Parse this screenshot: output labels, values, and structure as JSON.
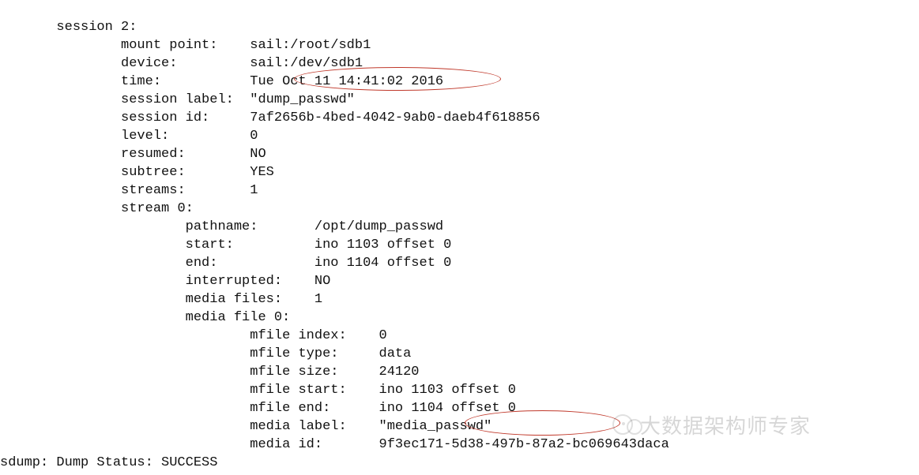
{
  "session": {
    "header": "session 2:",
    "mount_point_label": "mount point:",
    "mount_point_value": "sail:/root/sdb1",
    "device_label": "device:",
    "device_value": "sail:/dev/sdb1",
    "time_label": "time:",
    "time_value": "Tue Oct 11 14:41:02 2016",
    "session_label_label": "session label:",
    "session_label_value": "\"dump_passwd\"",
    "session_id_label": "session id:",
    "session_id_value": "7af2656b-4bed-4042-9ab0-daeb4f618856",
    "level_label": "level:",
    "level_value": "0",
    "resumed_label": "resumed:",
    "resumed_value": "NO",
    "subtree_label": "subtree:",
    "subtree_value": "YES",
    "streams_label": "streams:",
    "streams_value": "1",
    "stream0_header": "stream 0:"
  },
  "stream": {
    "pathname_label": "pathname:",
    "pathname_value": "/opt/dump_passwd",
    "start_label": "start:",
    "start_value": "ino 1103 offset 0",
    "end_label": "end:",
    "end_value": "ino 1104 offset 0",
    "interrupted_label": "interrupted:",
    "interrupted_value": "NO",
    "media_files_label": "media files:",
    "media_files_value": "1",
    "media_file0_header": "media file 0:"
  },
  "mfile": {
    "index_label": "mfile index:",
    "index_value": "0",
    "type_label": "mfile type:",
    "type_value": "data",
    "size_label": "mfile size:",
    "size_value": "24120",
    "start_label": "mfile start:",
    "start_value": "ino 1103 offset 0",
    "end_label": "mfile end:",
    "end_value": "ino 1104 offset 0",
    "media_label_label": "media label:",
    "media_label_value": "\"media_passwd\"",
    "media_id_label": "media id:",
    "media_id_value": "9f3ec171-5d38-497b-87a2-bc069643daca"
  },
  "footer": {
    "status_line": "sdump: Dump Status: SUCCESS"
  },
  "watermark": {
    "text": "大数据架构师专家"
  }
}
